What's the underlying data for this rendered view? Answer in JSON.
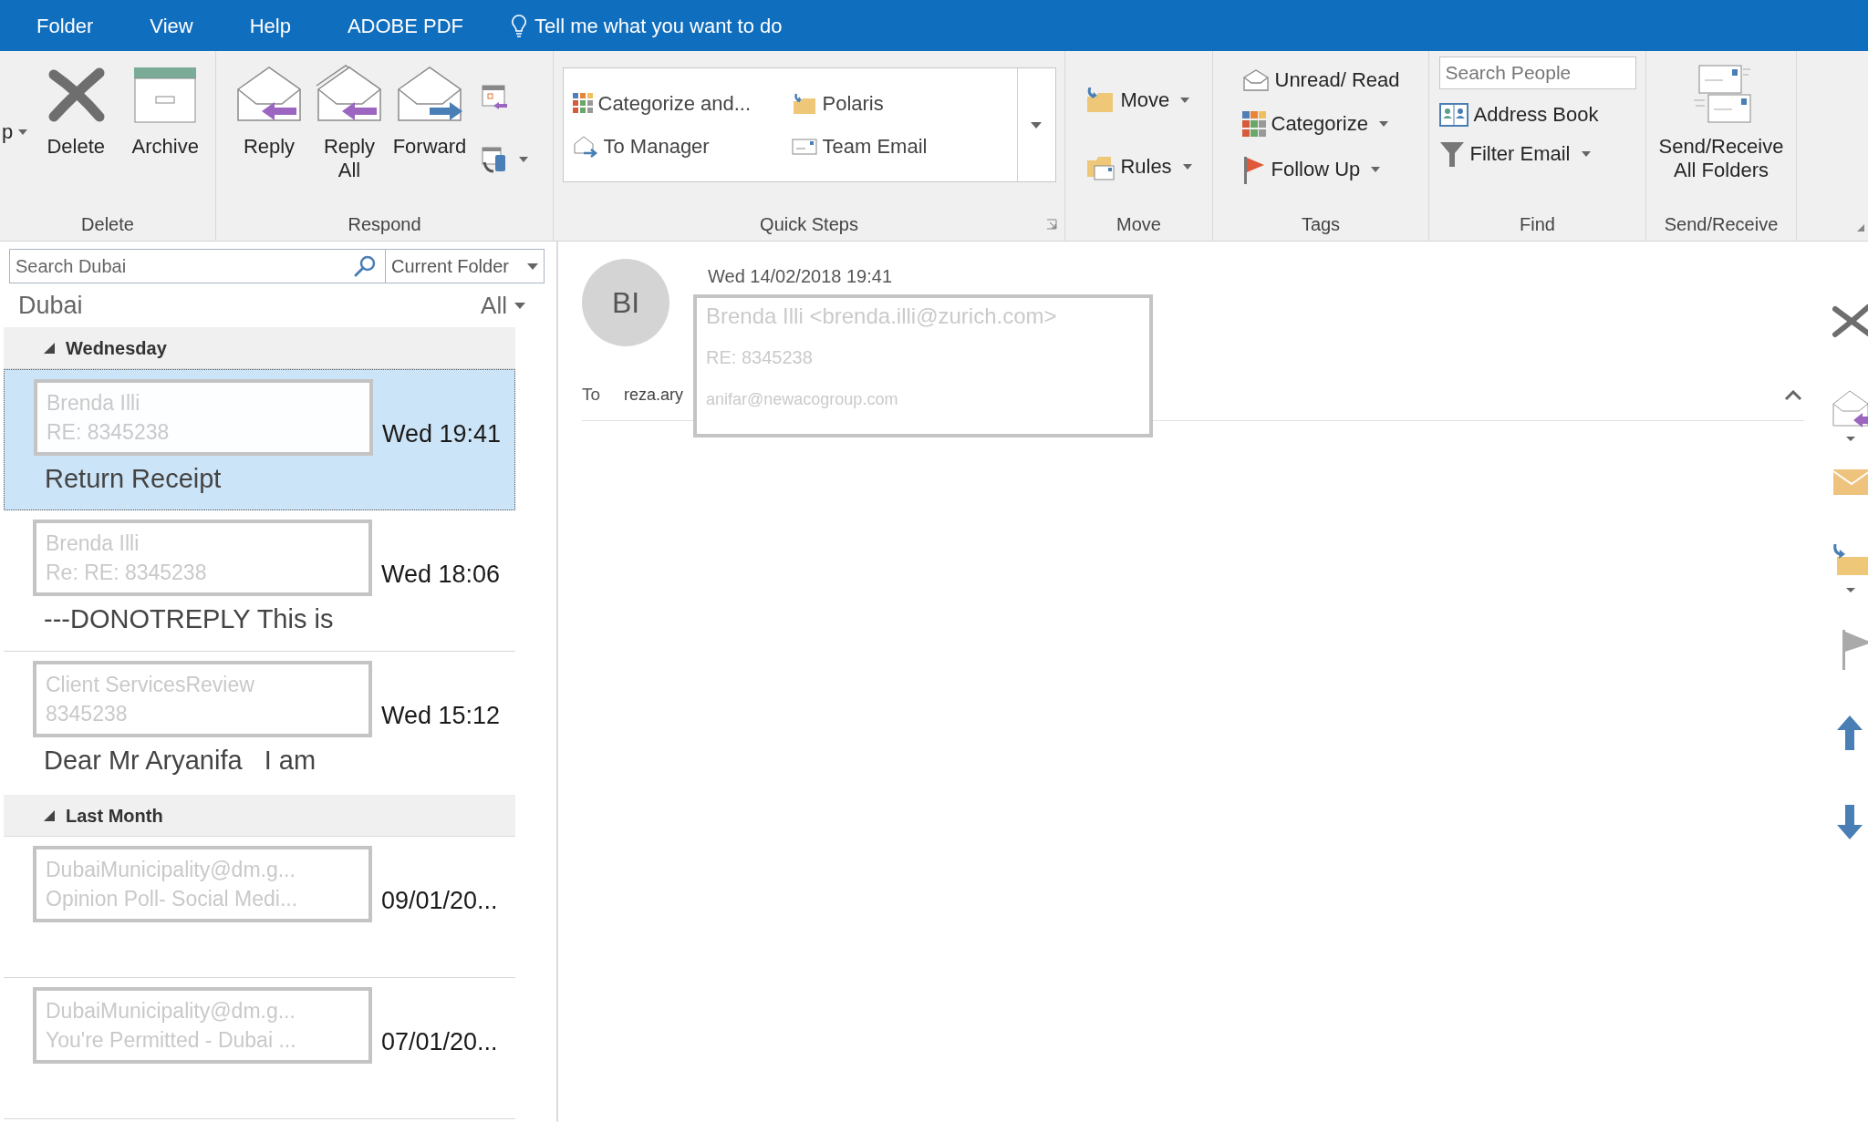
{
  "menu_tabs": [
    {
      "label": "Folder"
    },
    {
      "label": "View"
    },
    {
      "label": "Help"
    },
    {
      "label": "ADOBE PDF"
    }
  ],
  "tell_me": "Tell me what you want to do",
  "ribbon_groups": [
    {
      "label": "Delete",
      "items": [
        {
          "kind": "cut",
          "label": "p",
          "dropdown": true
        },
        {
          "kind": "large",
          "label": "Delete",
          "dropdown": false
        },
        {
          "kind": "large",
          "label": "Archive",
          "dropdown": false
        }
      ]
    },
    {
      "label": "Respond",
      "items": [
        {
          "kind": "large",
          "label": "Reply",
          "dropdown": false
        },
        {
          "kind": "large",
          "label": "Reply All",
          "dropdown": false
        },
        {
          "kind": "large",
          "label": "Forward",
          "dropdown": false
        },
        {
          "kind": "icon",
          "dropdown": false
        },
        {
          "kind": "icon",
          "dropdown": true
        }
      ]
    },
    {
      "label": "Quick Steps",
      "items": [
        {
          "kind": "gallery",
          "label": "Categorize and..."
        },
        {
          "kind": "gallery",
          "label": "Polaris"
        },
        {
          "kind": "gallery",
          "label": "To Manager"
        },
        {
          "kind": "gallery",
          "label": "Team Email"
        }
      ]
    },
    {
      "label": "Move",
      "items": [
        {
          "kind": "small",
          "label": "Move",
          "dropdown": true
        },
        {
          "kind": "small",
          "label": "Rules",
          "dropdown": true
        }
      ]
    },
    {
      "label": "Tags",
      "items": [
        {
          "kind": "small",
          "label": "Unread/ Read",
          "dropdown": false
        },
        {
          "kind": "small",
          "label": "Categorize",
          "dropdown": true
        },
        {
          "kind": "small",
          "label": "Follow Up",
          "dropdown": true
        }
      ]
    },
    {
      "label": "Find",
      "items": [
        {
          "kind": "search",
          "placeholder": "Search People"
        },
        {
          "kind": "small",
          "label": "Address Book",
          "dropdown": false
        },
        {
          "kind": "small",
          "label": "Filter Email",
          "dropdown": true
        }
      ]
    },
    {
      "label": "Send/Receive",
      "items": [
        {
          "kind": "large",
          "label": "Send/Receive All Folders",
          "dropdown": false
        }
      ]
    }
  ],
  "mail_list": {
    "search_placeholder": "Search Dubai",
    "scope": "Current Folder",
    "folder": "Dubai",
    "filter": "All",
    "groups": [
      {
        "label": "Wednesday",
        "expanded": true,
        "messages": [
          {
            "sender": "Brenda Illi",
            "subject": "RE: 8345238",
            "time": "Wed 19:41",
            "preview": "Return Receipt",
            "selected": true
          },
          {
            "sender": "Brenda Illi",
            "subject": "Re: RE: 8345238",
            "time": "Wed 18:06",
            "preview": "---DONOTREPLY This is",
            "selected": false
          },
          {
            "sender": "Client ServicesReview",
            "subject": "8345238",
            "time": "Wed 15:12",
            "preview": "Dear Mr Aryanifa   I am",
            "selected": false
          }
        ]
      },
      {
        "label": "Last Month",
        "expanded": true,
        "messages": [
          {
            "sender": "DubaiMunicipality@dm.g...",
            "subject": "Opinion Poll- Social Medi...",
            "time": "09/01/20...",
            "selected": false
          },
          {
            "sender": "DubaiMunicipality@dm.g...",
            "subject": "You're Permitted - Dubai ...",
            "time": "07/01/20...",
            "selected": false
          }
        ]
      }
    ]
  },
  "reading_pane": {
    "initials": "BI",
    "date": "Wed 14/02/2018 19:41",
    "from": "Brenda Illi <brenda.illi@zurich.com>",
    "subject": "RE: 8345238",
    "to_label": "To",
    "to": "reza.ary",
    "to_covered": "anifar@newacogroup.com"
  }
}
